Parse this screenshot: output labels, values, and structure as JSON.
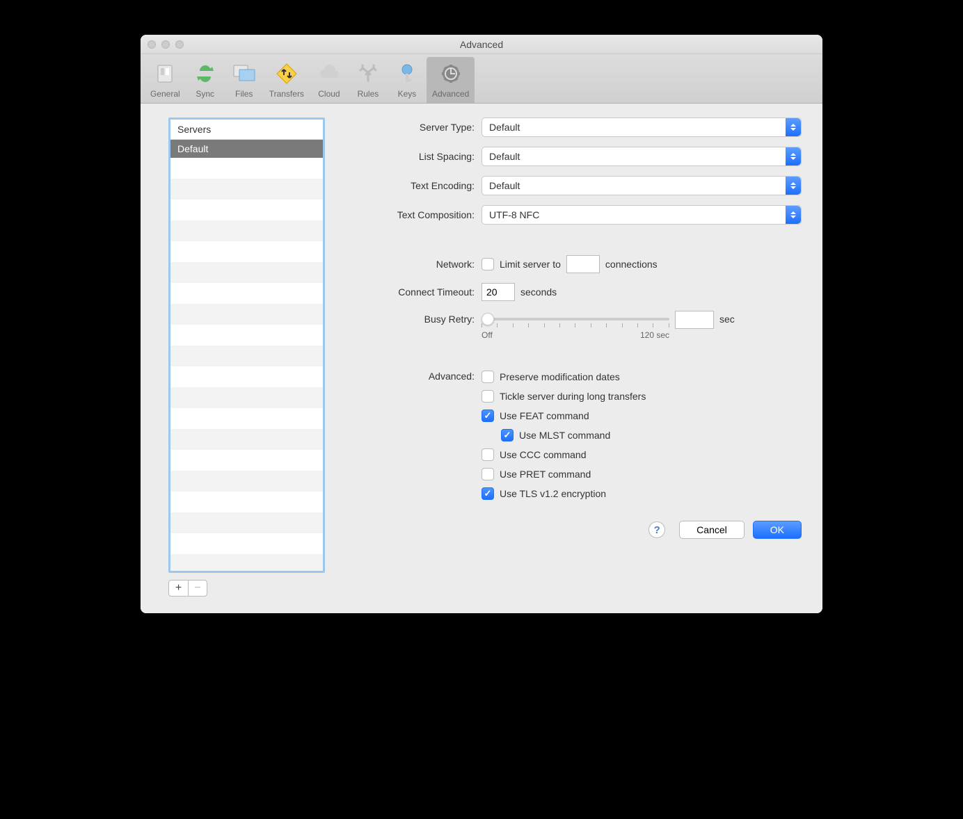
{
  "window": {
    "title": "Advanced"
  },
  "toolbar": {
    "items": [
      {
        "label": "General"
      },
      {
        "label": "Sync"
      },
      {
        "label": "Files"
      },
      {
        "label": "Transfers"
      },
      {
        "label": "Cloud"
      },
      {
        "label": "Rules"
      },
      {
        "label": "Keys"
      },
      {
        "label": "Advanced"
      }
    ]
  },
  "sidebar": {
    "header": "Servers",
    "items": [
      "Default"
    ]
  },
  "form": {
    "serverType": {
      "label": "Server Type:",
      "value": "Default"
    },
    "listSpacing": {
      "label": "List Spacing:",
      "value": "Default"
    },
    "textEncoding": {
      "label": "Text Encoding:",
      "value": "Default"
    },
    "textComposition": {
      "label": "Text Composition:",
      "value": "UTF-8 NFC"
    },
    "network": {
      "label": "Network:",
      "checkLabelPrefix": "Limit server to",
      "checkLabelSuffix": "connections",
      "value": ""
    },
    "connectTimeout": {
      "label": "Connect Timeout:",
      "value": "20",
      "unit": "seconds"
    },
    "busyRetry": {
      "label": "Busy Retry:",
      "value": "",
      "unit": "sec",
      "min": "Off",
      "max": "120 sec"
    },
    "advanced": {
      "label": "Advanced:",
      "options": [
        {
          "label": "Preserve modification dates",
          "checked": false,
          "indent": false
        },
        {
          "label": "Tickle server during long transfers",
          "checked": false,
          "indent": false
        },
        {
          "label": "Use FEAT command",
          "checked": true,
          "indent": false
        },
        {
          "label": "Use MLST command",
          "checked": true,
          "indent": true
        },
        {
          "label": "Use CCC command",
          "checked": false,
          "indent": false
        },
        {
          "label": "Use PRET command",
          "checked": false,
          "indent": false
        },
        {
          "label": "Use TLS v1.2 encryption",
          "checked": true,
          "indent": false
        }
      ]
    }
  },
  "buttons": {
    "help": "?",
    "cancel": "Cancel",
    "ok": "OK"
  }
}
